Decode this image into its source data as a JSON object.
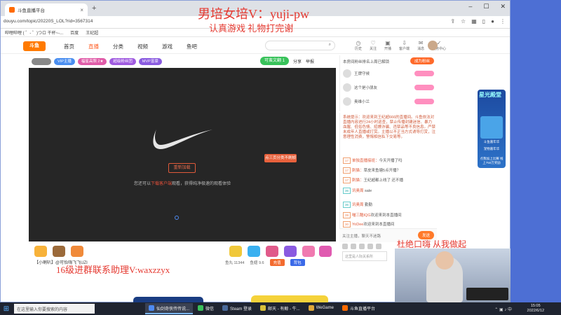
{
  "browser": {
    "tab_title": "斗鱼直播平台",
    "url": "douyu.com/topic/20220S_LOL?rid=3567314",
    "bookmarks": [
      "哔哩哔哩 ( ゜- ゜)つロ 干杯~-...",
      "百度",
      "王纪超"
    ]
  },
  "site_nav": {
    "logo_text": "斗鱼",
    "links": [
      "首页",
      "直播",
      "分类",
      "视频",
      "游戏",
      "鱼吧"
    ],
    "active_index": 1,
    "search_placeholder": "",
    "top_icons": [
      "历史",
      "关注",
      "开播",
      "客户端",
      "消息",
      "任务中心"
    ]
  },
  "stage": {
    "badges": [
      "VIP主播",
      "福星高照 2★",
      "超级粉丝团",
      "MVP富豪"
    ],
    "fans_button": "可蛮文翻 1",
    "share": "分享",
    "report": "举报",
    "open_button": "重新加载",
    "tip_prefix": "您还可以",
    "tip_highlight": "下载客户端",
    "tip_suffix": "观看，获得纯净极速的观看体验",
    "orange_button": "点三页分类不刷帧"
  },
  "gift_bar": {
    "gifts": [
      "王者吃鸡",
      "猫咪",
      "火箭",
      "超级火箭",
      "飞机",
      "办卡",
      "粉丝团",
      "嘉年华",
      "钻石"
    ],
    "bot_text": "【小喇叭】@可怡嗨飞飞UZI",
    "stats": [
      "鱼丸 11344",
      "鱼翅 9.6"
    ],
    "recharge": "充值",
    "shop": "背包"
  },
  "rank": {
    "header": "本房间粉丝排名上周已解锁",
    "join": "成为粉丝",
    "rows": [
      "王牌守候",
      "这个是小朋友",
      "奥维小兰"
    ]
  },
  "chat": {
    "system": "系统提示：欢迎来到王纪超666的直播间。斗鱼依法对直播内容进行24小时巡查，禁止传播封建迷信、暴力血腥、低俗色情、招嫖诈骗、违禁品等不良信息。严禁未成年人直播或打赏。主播以不正当方式诱导打赏，注意理性消费，警惕相信私下交易等。",
    "messages": [
      {
        "level": "17",
        "user": "单独直播接班：",
        "text": "今天开播了吗"
      },
      {
        "level": "17",
        "user": "刺猫：",
        "text": "草皮来鱼塘5点开播？"
      },
      {
        "level": "17",
        "user": "刺猫：",
        "text": "王纪超都上线了 还不播"
      },
      {
        "level": "36",
        "user": "讯奥周 ",
        "text": "sale"
      },
      {
        "level": "36",
        "user": "讯奥周 ",
        "text": "勤勤"
      },
      {
        "level": "39",
        "user": "喵三酷IQG",
        "text": "欢迎来到本直播间"
      },
      {
        "level": "30",
        "user": "YoDee",
        "text": "欢迎来到本直播间"
      }
    ],
    "input_placeholder": "关注主播，聊天不迷路",
    "send": "发送",
    "bottom_hint": "这里是人际关系所"
  },
  "side_banner": {
    "title": "星光殿堂",
    "items": [
      "斗鱼嘉年华",
      "宠物嘉年华"
    ],
    "footer": "点我加上比赛 线上750万奖励"
  },
  "overlays": {
    "title": "男培女培V：yuji-pw",
    "subtitle": "认真游戏  礼物打完谢",
    "left": "16级进群联系助理V:waxzzyx",
    "right": "杜绝口嗨 从我做起"
  },
  "taskbar": {
    "search": "在这里输入你要搜索的内容",
    "items": [
      "仙剑奇侠传传说...",
      "微信",
      "Steam 登录",
      "邮天 - 有鲸 - 牛...",
      "WeGame",
      "斗鱼直播平台"
    ],
    "active_index": 0,
    "time": "15:05",
    "date": "2022/6/12"
  },
  "colors": {
    "accent": "#ff5d23",
    "overlay_red": "#e5382f",
    "taskbar": "#1f2430"
  }
}
